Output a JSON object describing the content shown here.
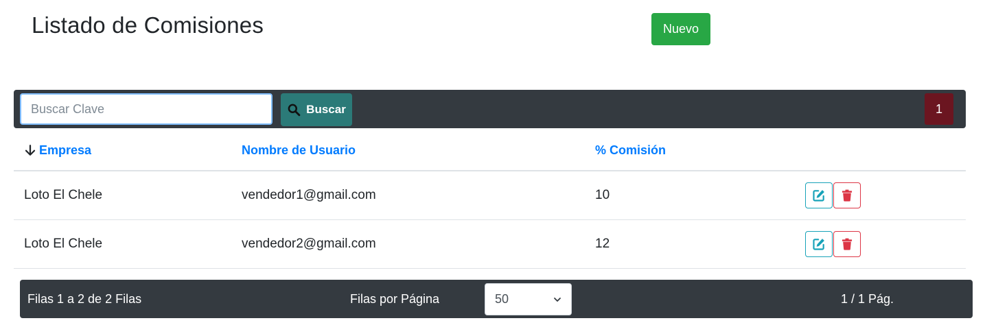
{
  "header": {
    "title": "Listado de Comisiones",
    "new_label": "Nuevo"
  },
  "toolbar": {
    "search_placeholder": "Buscar Clave",
    "search_value": "",
    "search_label": "Buscar",
    "current_page": "1"
  },
  "table": {
    "columns": [
      "Empresa",
      "Nombre de Usuario",
      "% Comisión"
    ],
    "sort_column": "Empresa",
    "sort_direction": "descending",
    "rows": [
      {
        "empresa": "Loto El Chele",
        "usuario": "vendedor1@gmail.com",
        "comision": "10"
      },
      {
        "empresa": "Loto El Chele",
        "usuario": "vendedor2@gmail.com",
        "comision": "12"
      }
    ]
  },
  "footer": {
    "rows_info": "Filas 1 a 2 de 2 Filas",
    "rows_per_page_label": "Filas por Página",
    "rows_per_page_value": "50",
    "page_info": "1 / 1 Pág."
  },
  "icons": {
    "search": "search-icon",
    "sort": "arrow-down-icon",
    "edit": "edit-icon",
    "delete": "trash-icon",
    "dropdown": "chevron-down-icon"
  },
  "colors": {
    "primary_text": "#007bff",
    "new_button": "#28a745",
    "search_button": "#2b7a78",
    "page_button": "#6b1520",
    "bar": "#343a40",
    "edit": "#17a2b8",
    "delete": "#dc3545"
  }
}
